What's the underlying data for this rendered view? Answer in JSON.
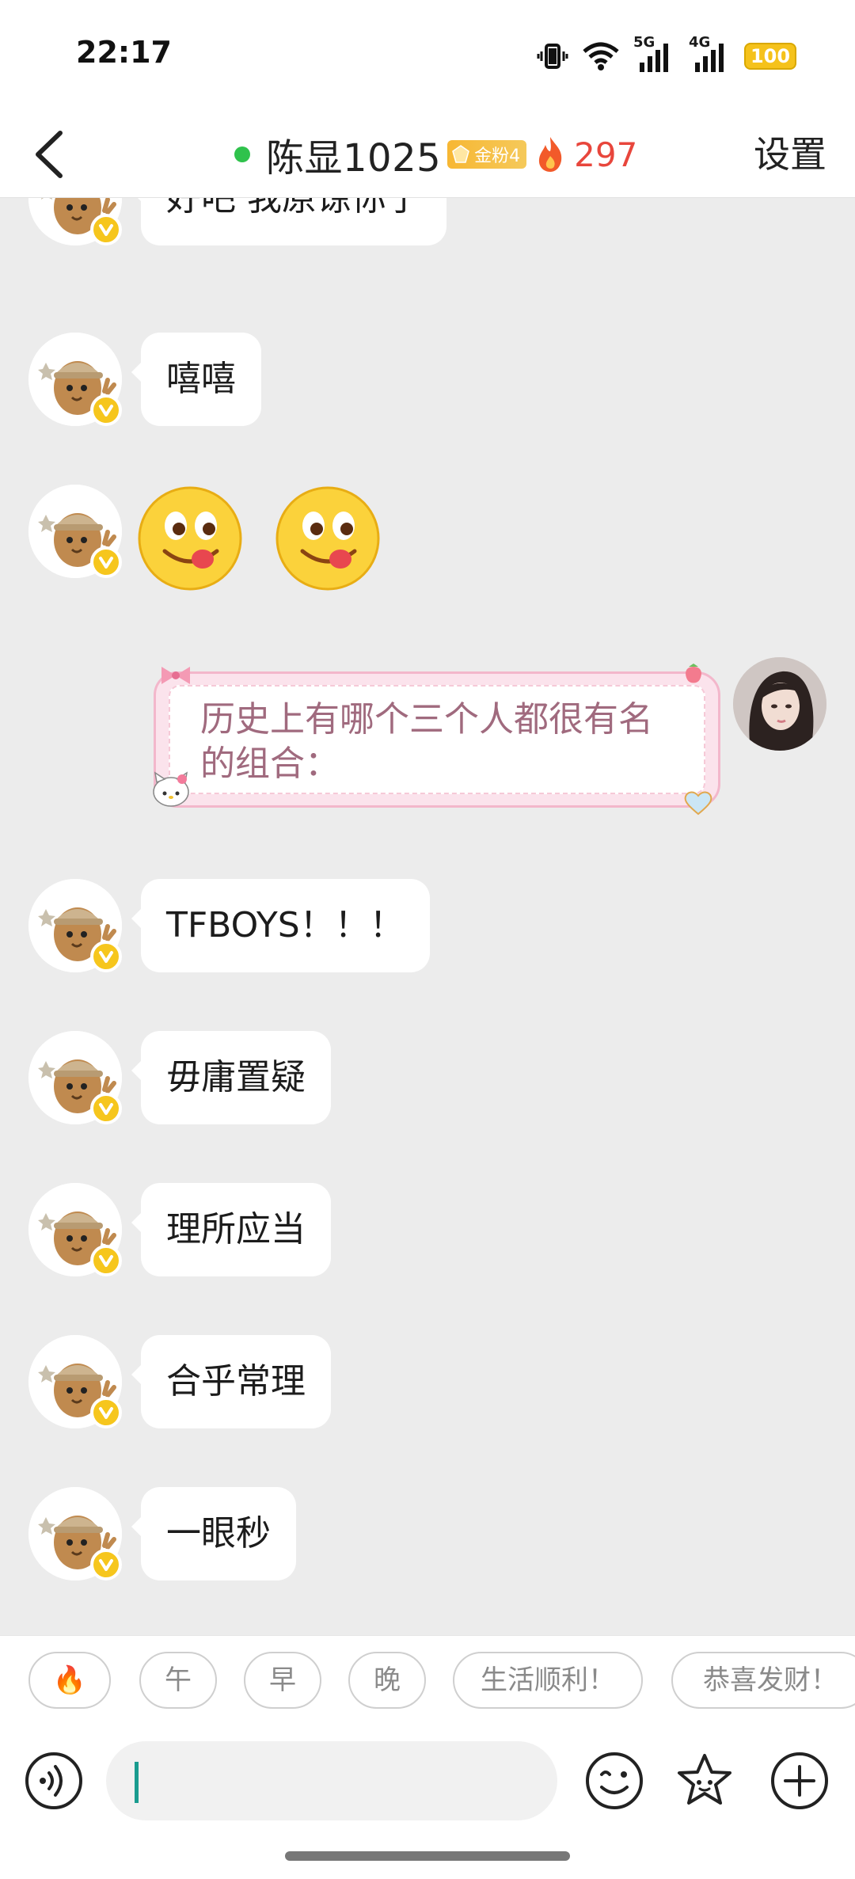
{
  "status_bar": {
    "time": "22:17",
    "network_5g": "5G",
    "network_4g": "4G",
    "battery": "100"
  },
  "header": {
    "contact_name": "陈显1025",
    "fan_badge": "金粉4",
    "streak": "297",
    "settings_label": "设置"
  },
  "messages": [
    {
      "type": "text",
      "text": "好吧 我原谅你了"
    },
    {
      "type": "text",
      "text": "嘻嘻"
    },
    {
      "type": "emoji",
      "emoji": "yum-face-icon"
    },
    {
      "type": "sent",
      "text": "历史上有哪个三个人都很有名的组合："
    },
    {
      "type": "text",
      "text": "TFBOYS！！！"
    },
    {
      "type": "text",
      "text": "毋庸置疑"
    },
    {
      "type": "text",
      "text": "理所应当"
    },
    {
      "type": "text",
      "text": "合乎常理"
    },
    {
      "type": "text",
      "text": "一眼秒"
    }
  ],
  "quick_replies": [
    "🔥",
    "午",
    "早",
    "晚",
    "生活顺利！",
    "恭喜发财！"
  ],
  "input": {
    "value": "",
    "placeholder": ""
  },
  "colors": {
    "online": "#2fc24c",
    "streak": "#e8463c",
    "badge": "#f7b733",
    "verified": "#f6c61d",
    "sent_text": "#a06a7e"
  }
}
